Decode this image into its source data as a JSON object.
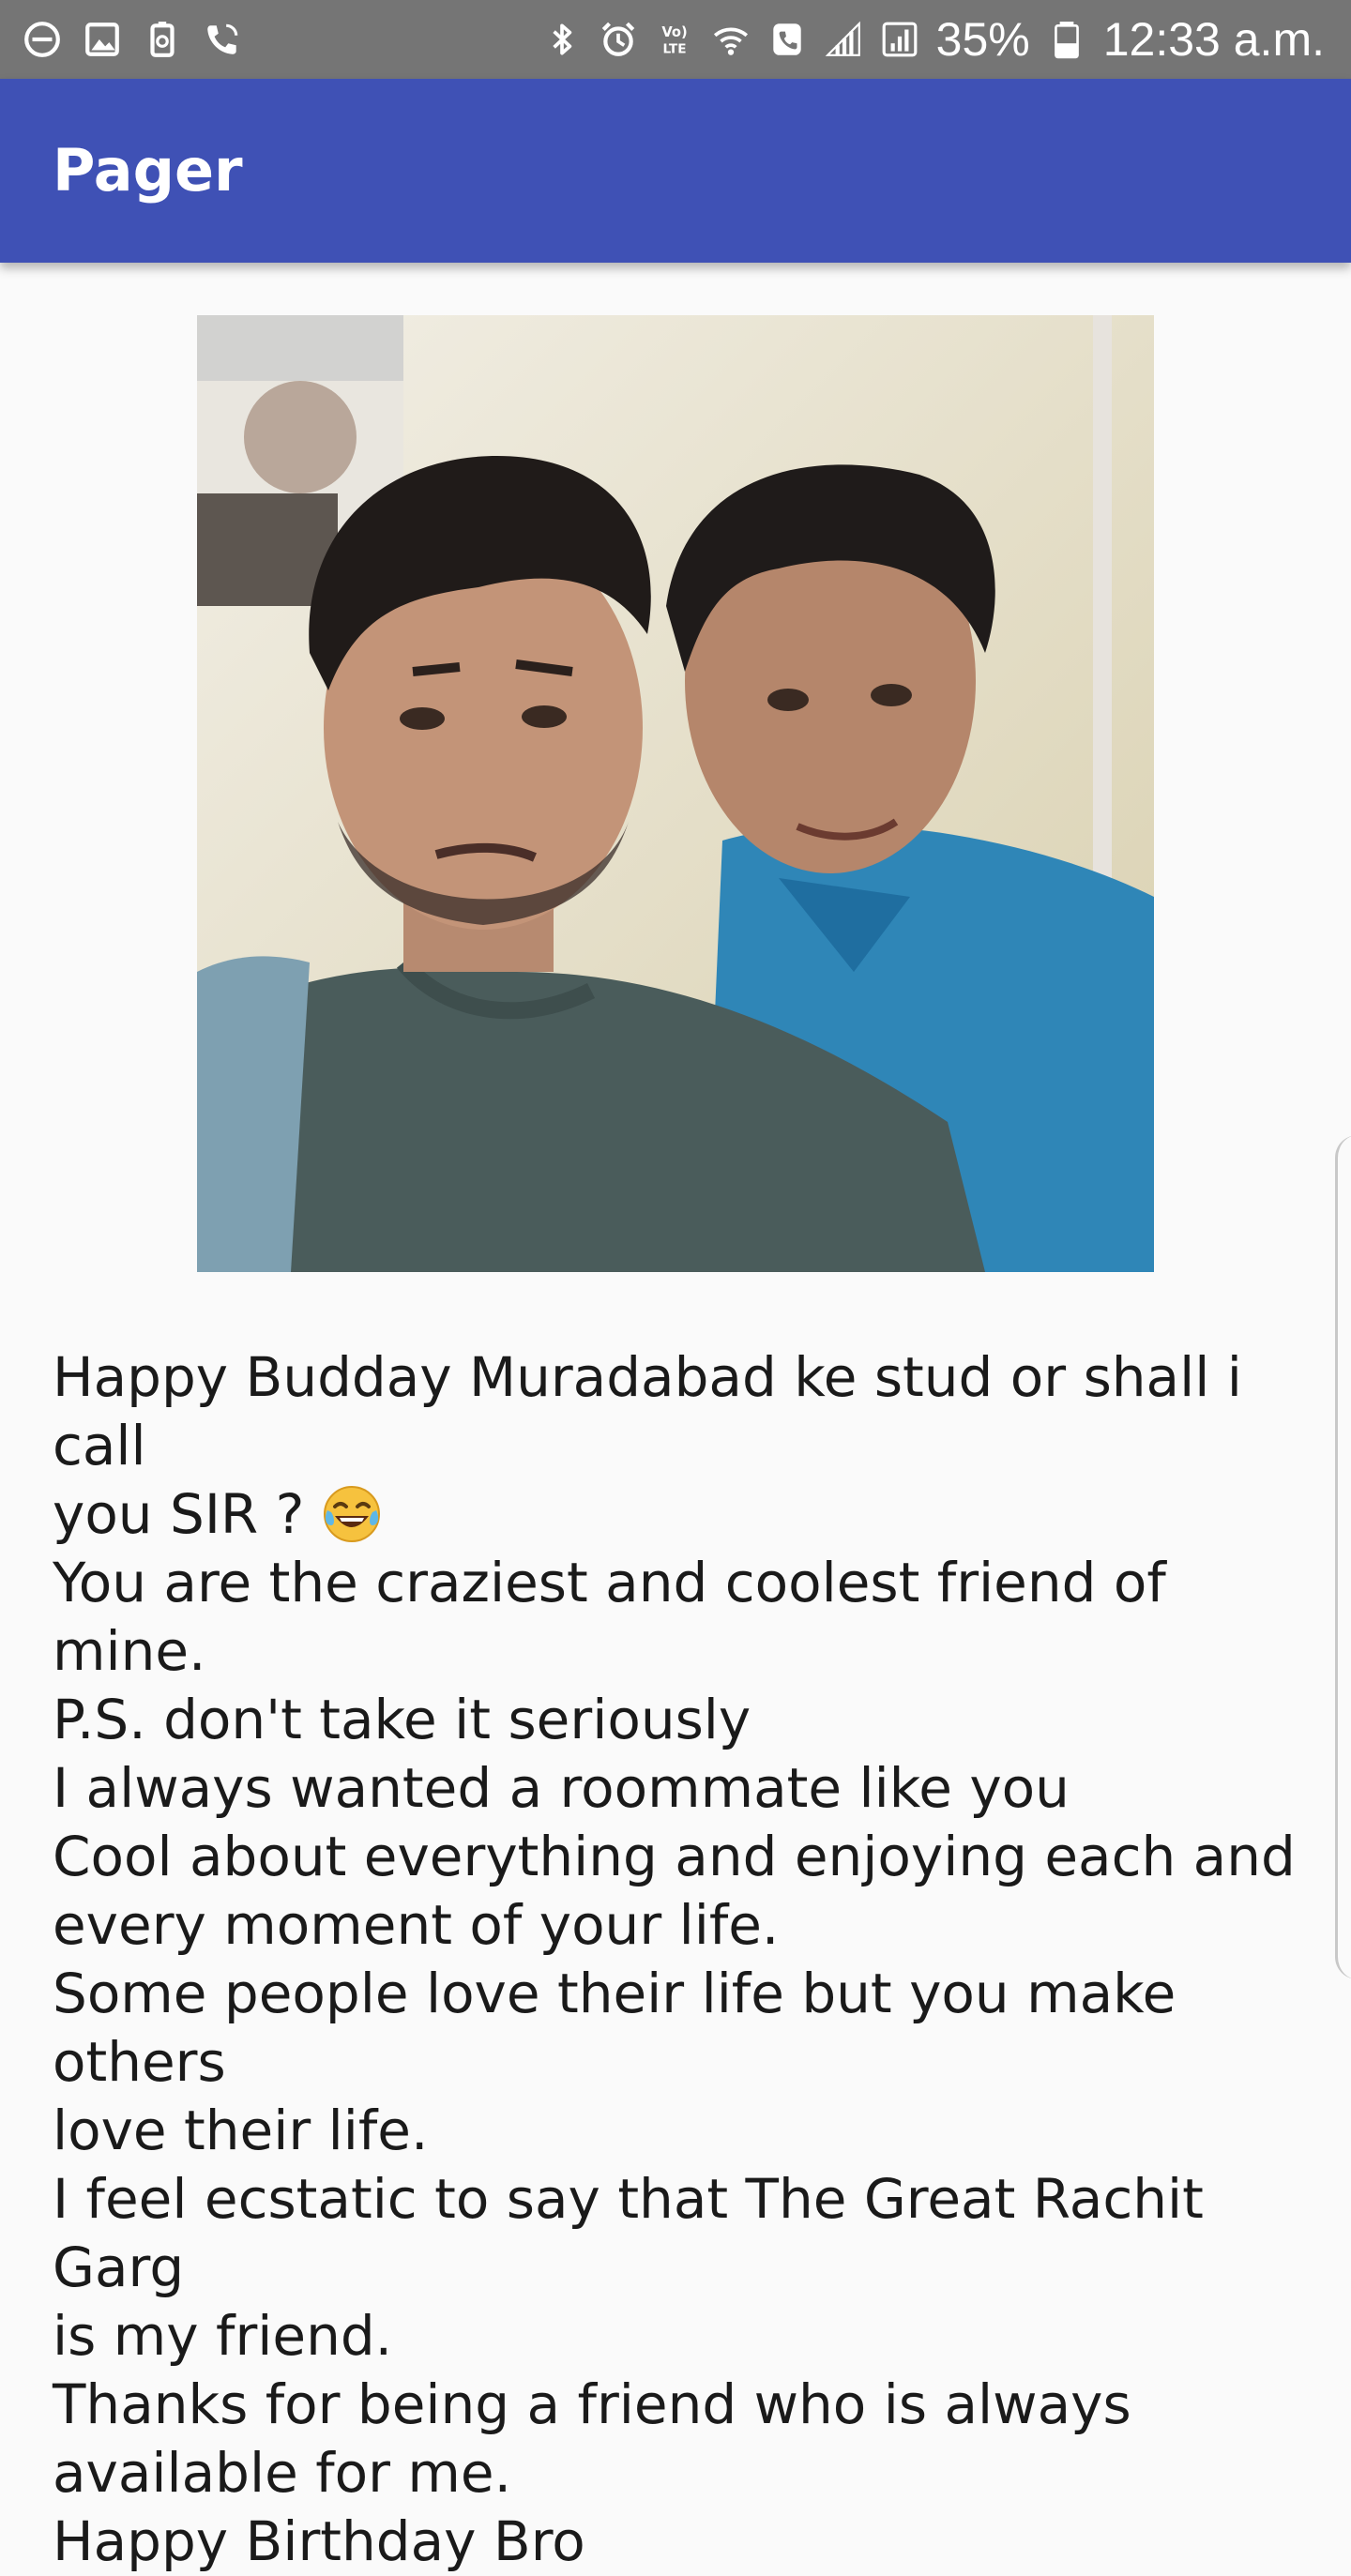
{
  "status_bar": {
    "left_icons": [
      "do-not-disturb-icon",
      "image-icon",
      "battery-saver-icon",
      "wifi-calling-icon"
    ],
    "right_icons": [
      "bluetooth-icon",
      "alarm-icon",
      "volte-icon",
      "wifi-icon",
      "call-icon",
      "signal-icon",
      "signal-icon"
    ],
    "battery_percent": "35%",
    "time": "12:33 a.m."
  },
  "app_bar": {
    "title": "Pager",
    "color": "#3f51b5"
  },
  "content": {
    "photo": {
      "icon": "photo-of-two-friends"
    },
    "message_lines": [
      "Happy Budday Muradabad ke stud or shall i call",
      "you SIR ?",
      "You are the craziest and coolest friend of mine.",
      "P.S. don't take it seriously",
      "I always wanted a roommate like you",
      "Cool about everything and enjoying each and",
      "every moment of your life.",
      "Some people love their life but you make others",
      "love their life.",
      "I feel ecstatic to say that The Great Rachit Garg",
      "is my friend.",
      "Thanks for being a friend who is always",
      "available for me.",
      "Happy Birthday Bro"
    ],
    "emoji": "laughing-tears-emoji"
  },
  "colors": {
    "status_bar": "#757575",
    "background": "#fafafa",
    "text": "#1a1a1a"
  }
}
